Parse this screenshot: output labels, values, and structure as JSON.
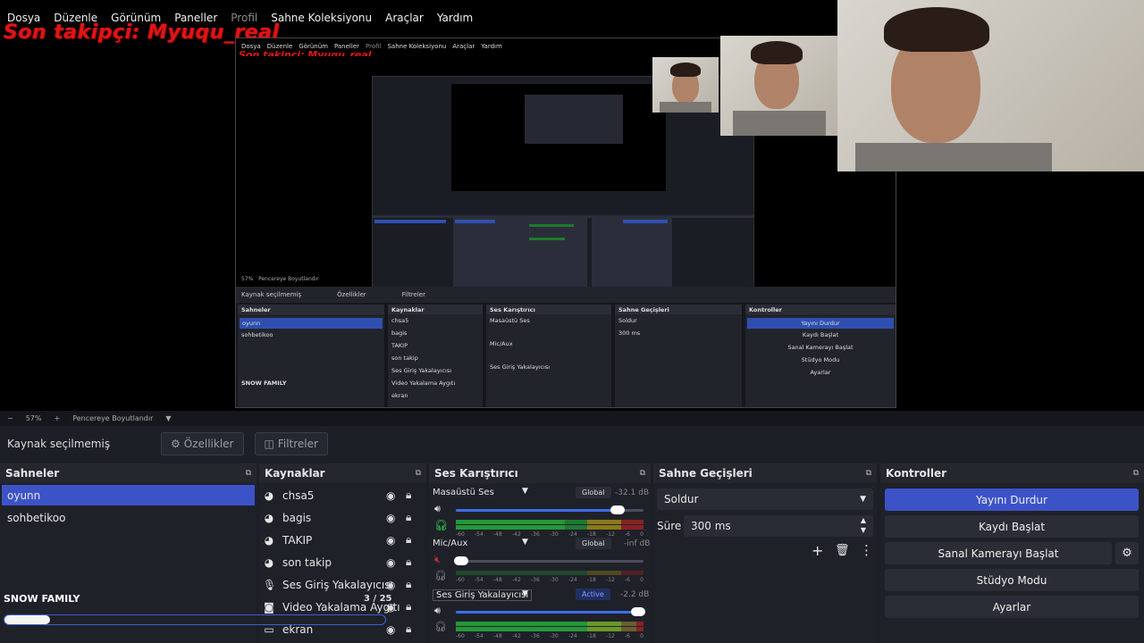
{
  "menu": [
    "Dosya",
    "Düzenle",
    "Görünüm",
    "Paneller",
    "Profil",
    "Sahne Koleksiyonu",
    "Araçlar",
    "Yardım"
  ],
  "overlay_text": "Son takipçi: Myuqu_real",
  "zoom": {
    "minus": "−",
    "percent": "57%",
    "plus": "+",
    "fit_label": "Pencereye Boyutlandır",
    "dropdown": "▼"
  },
  "source_bar": {
    "status": "Kaynak seçilmemiş",
    "properties": "Özellikler",
    "filters": "Filtreler",
    "gear_icon": "⚙",
    "filter_icon": "◫"
  },
  "scenes": {
    "title": "Sahneler",
    "items": [
      "oyunn",
      "sohbetikoo"
    ],
    "active_index": 0
  },
  "sources": {
    "title": "Kaynaklar",
    "items": [
      {
        "name": "chsa5",
        "icon": "globe-icon"
      },
      {
        "name": "bagis",
        "icon": "globe-icon"
      },
      {
        "name": "TAKIP",
        "icon": "globe-icon"
      },
      {
        "name": "son takip",
        "icon": "globe-icon"
      },
      {
        "name": "Ses Giriş Yakalayıcısı",
        "icon": "mic-icon"
      },
      {
        "name": "Video Yakalama Aygıtı",
        "icon": "camera-icon"
      },
      {
        "name": "ekran",
        "icon": "monitor-icon"
      }
    ]
  },
  "mixer": {
    "title": "Ses Karıştırıcı",
    "channels": [
      {
        "name": "Masaüstü Ses",
        "tag": "Global",
        "db": "-32.1 dB",
        "volume_fraction": 0.86,
        "meter_fraction": 0.58,
        "muted": false
      },
      {
        "name": "Mic/Aux",
        "tag": "Global",
        "db": "-inf dB",
        "volume_fraction": 0.03,
        "meter_fraction": 0.0,
        "muted": true
      },
      {
        "name": "Ses Giriş Yakalayıcısı",
        "tag": "Active",
        "db": "-2.2 dB",
        "volume_fraction": 0.97,
        "meter_fraction": 0.96,
        "muted": false
      }
    ],
    "ticks": [
      "-60",
      "-54",
      "-48",
      "-42",
      "-36",
      "-30",
      "-24",
      "-18",
      "-12",
      "-6",
      "0"
    ]
  },
  "transitions": {
    "title": "Sahne Geçişleri",
    "type": "Soldur",
    "duration_label": "Süre",
    "duration": "300 ms",
    "add": "+",
    "delete": "🗑",
    "more": "⋮"
  },
  "controls": {
    "title": "Kontroller",
    "buttons": [
      "Yayını Durdur",
      "Kaydı Başlat",
      "Sanal Kamerayı Başlat",
      "Stüdyo Modu",
      "Ayarlar"
    ],
    "gear": "⚙"
  },
  "snow": {
    "label": "SNOW FAMILY",
    "counter": "3 / 25",
    "progress": 0.12
  },
  "nested": {
    "menu": [
      "Dosya",
      "Düzenle",
      "Görünüm",
      "Paneller",
      "Profil",
      "Sahne Koleksiyonu",
      "Araçlar",
      "Yardım"
    ],
    "overlay": "Son takipçi: Myuqu_real",
    "zoom": "57%",
    "fit": "Pencereye Boyutlandır",
    "status": "Kaynak seçilmemiş",
    "properties": "Özellikler",
    "filters": "Filtreler"
  },
  "colors": {
    "accent": "#3c53c8",
    "overlay": "#e01515",
    "panel": "#1f2129"
  }
}
